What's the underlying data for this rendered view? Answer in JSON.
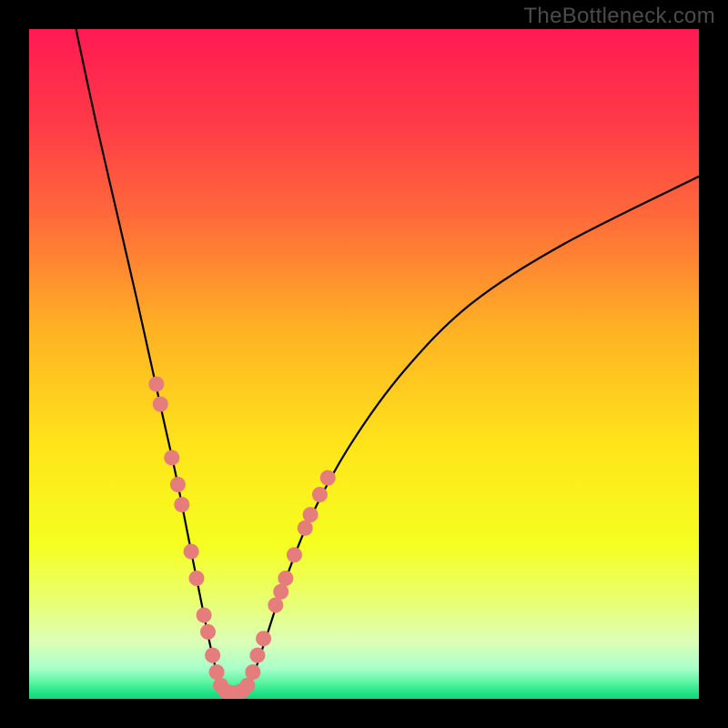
{
  "watermark": "TheBottleneck.com",
  "colors": {
    "frame": "#000000",
    "curve": "#000000",
    "dot": "#e47d7b",
    "gradient_stops": [
      {
        "offset": 0.0,
        "color": "#ff1a52"
      },
      {
        "offset": 0.14,
        "color": "#ff3a48"
      },
      {
        "offset": 0.28,
        "color": "#ff6a3a"
      },
      {
        "offset": 0.45,
        "color": "#ffb224"
      },
      {
        "offset": 0.62,
        "color": "#ffe41a"
      },
      {
        "offset": 0.77,
        "color": "#f5ff20"
      },
      {
        "offset": 0.86,
        "color": "#e8ff78"
      },
      {
        "offset": 0.915,
        "color": "#dcffb8"
      },
      {
        "offset": 0.955,
        "color": "#a8ffca"
      },
      {
        "offset": 0.975,
        "color": "#5cf5a2"
      },
      {
        "offset": 0.99,
        "color": "#24e489"
      },
      {
        "offset": 1.0,
        "color": "#15d57c"
      }
    ]
  },
  "chart_data": {
    "type": "line",
    "title": "",
    "xlabel": "",
    "ylabel": "",
    "xlim": [
      0,
      100
    ],
    "ylim": [
      0,
      100
    ],
    "grid": false,
    "legend": false,
    "notes": "V-shaped bottleneck curve. Y decreases from ~100 at x≈7 to ~0 around x≈28–32 (flat minimum) then rises with diminishing slope toward ~78 at x=100.",
    "series": [
      {
        "name": "bottleneck-curve",
        "x": [
          7,
          10,
          13,
          16,
          18,
          20,
          22,
          24,
          26,
          27.5,
          29,
          31,
          33,
          35,
          38,
          42,
          48,
          56,
          66,
          80,
          100
        ],
        "y": [
          100,
          86,
          73,
          60,
          51,
          42,
          33,
          23,
          13,
          6,
          1.2,
          0.8,
          2.5,
          8,
          17,
          27,
          38,
          49,
          59,
          68,
          78
        ]
      }
    ],
    "highlight_points": {
      "name": "marker-dots",
      "note": "Clustered salmon dots near the trough on both branches plus along the flat bottom.",
      "points": [
        {
          "x": 19.0,
          "y": 47
        },
        {
          "x": 19.6,
          "y": 44
        },
        {
          "x": 21.3,
          "y": 36
        },
        {
          "x": 22.2,
          "y": 32
        },
        {
          "x": 22.8,
          "y": 29
        },
        {
          "x": 24.2,
          "y": 22
        },
        {
          "x": 25.0,
          "y": 18
        },
        {
          "x": 26.1,
          "y": 12.5
        },
        {
          "x": 26.7,
          "y": 10
        },
        {
          "x": 27.4,
          "y": 6.5
        },
        {
          "x": 28.0,
          "y": 4.0
        },
        {
          "x": 28.6,
          "y": 2.0
        },
        {
          "x": 29.4,
          "y": 1.1
        },
        {
          "x": 30.2,
          "y": 0.9
        },
        {
          "x": 31.0,
          "y": 0.9
        },
        {
          "x": 31.8,
          "y": 1.2
        },
        {
          "x": 32.6,
          "y": 2.0
        },
        {
          "x": 33.4,
          "y": 4.0
        },
        {
          "x": 34.1,
          "y": 6.5
        },
        {
          "x": 35.0,
          "y": 9.0
        },
        {
          "x": 36.8,
          "y": 14.0
        },
        {
          "x": 37.6,
          "y": 16.0
        },
        {
          "x": 38.3,
          "y": 18.0
        },
        {
          "x": 39.6,
          "y": 21.5
        },
        {
          "x": 41.2,
          "y": 25.5
        },
        {
          "x": 42.0,
          "y": 27.5
        },
        {
          "x": 43.4,
          "y": 30.5
        },
        {
          "x": 44.6,
          "y": 33.0
        }
      ]
    }
  }
}
